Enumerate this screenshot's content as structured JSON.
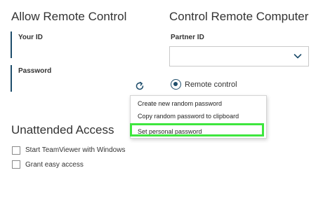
{
  "allow_remote": {
    "heading": "Allow Remote Control",
    "your_id_label": "Your ID",
    "password_label": "Password"
  },
  "control_remote": {
    "heading": "Control Remote Computer",
    "partner_id_label": "Partner ID",
    "partner_id_value": "",
    "radio_label": "Remote control",
    "radio_selected": true
  },
  "password_menu": {
    "items": [
      "Create new random password",
      "Copy random password to clipboard",
      "Set personal password"
    ],
    "highlighted_item": "Set personal password",
    "highlight_color": "#3ee63e"
  },
  "unattended": {
    "heading": "Unattended Access",
    "options": [
      {
        "label": "Start TeamViewer with Windows",
        "checked": false
      },
      {
        "label": "Grant easy access",
        "checked": false
      }
    ]
  },
  "icons": {
    "refresh": "refresh-icon",
    "dropdown": "chevron-down-icon"
  },
  "colors": {
    "accent": "#1e4d6b",
    "highlight": "#3ee63e"
  }
}
